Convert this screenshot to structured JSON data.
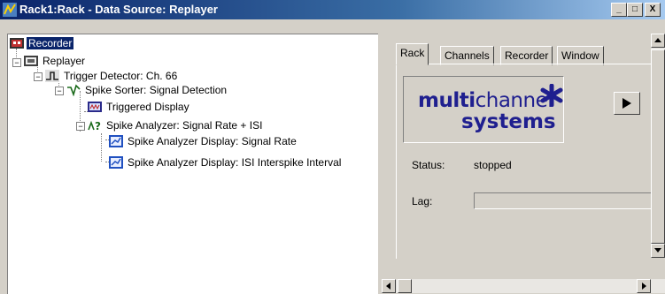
{
  "window": {
    "title": "Rack1:Rack - Data Source: Replayer",
    "controls": [
      "_",
      "□",
      "X"
    ]
  },
  "tree": {
    "nodes": [
      {
        "label": "Recorder",
        "icon": "recorder-icon",
        "selected": true
      },
      {
        "label": "Replayer",
        "icon": "replayer-icon"
      },
      {
        "label": "Trigger Detector: Ch. 66",
        "icon": "trigger-detector-icon"
      },
      {
        "label": "Spike Sorter: Signal Detection",
        "icon": "spike-sorter-icon"
      },
      {
        "label": "Triggered Display",
        "icon": "triggered-display-icon"
      },
      {
        "label": "Spike Analyzer: Signal Rate + ISI",
        "icon": "spike-analyzer-icon"
      },
      {
        "label": "Spike Analyzer Display: Signal Rate",
        "icon": "analyzer-display-icon"
      },
      {
        "label": "Spike Analyzer Display: ISI Interspike Interval",
        "icon": "analyzer-display-icon"
      }
    ]
  },
  "tabs": [
    {
      "label": "Rack",
      "active": true
    },
    {
      "label": "Channels"
    },
    {
      "label": "Recorder"
    },
    {
      "label": "Window"
    }
  ],
  "logo": {
    "part1_bold": "multi",
    "part1_thin": "channel",
    "part2": "systems",
    "color": "#1f1f8f"
  },
  "status": {
    "label": "Status:",
    "value": "stopped"
  },
  "lag": {
    "label": "Lag:",
    "value": ""
  },
  "play_button": {
    "icon": "play-icon"
  },
  "colors": {
    "title_bar": "#0a246a",
    "selection": "#0a246a",
    "face": "#d4d0c8"
  }
}
